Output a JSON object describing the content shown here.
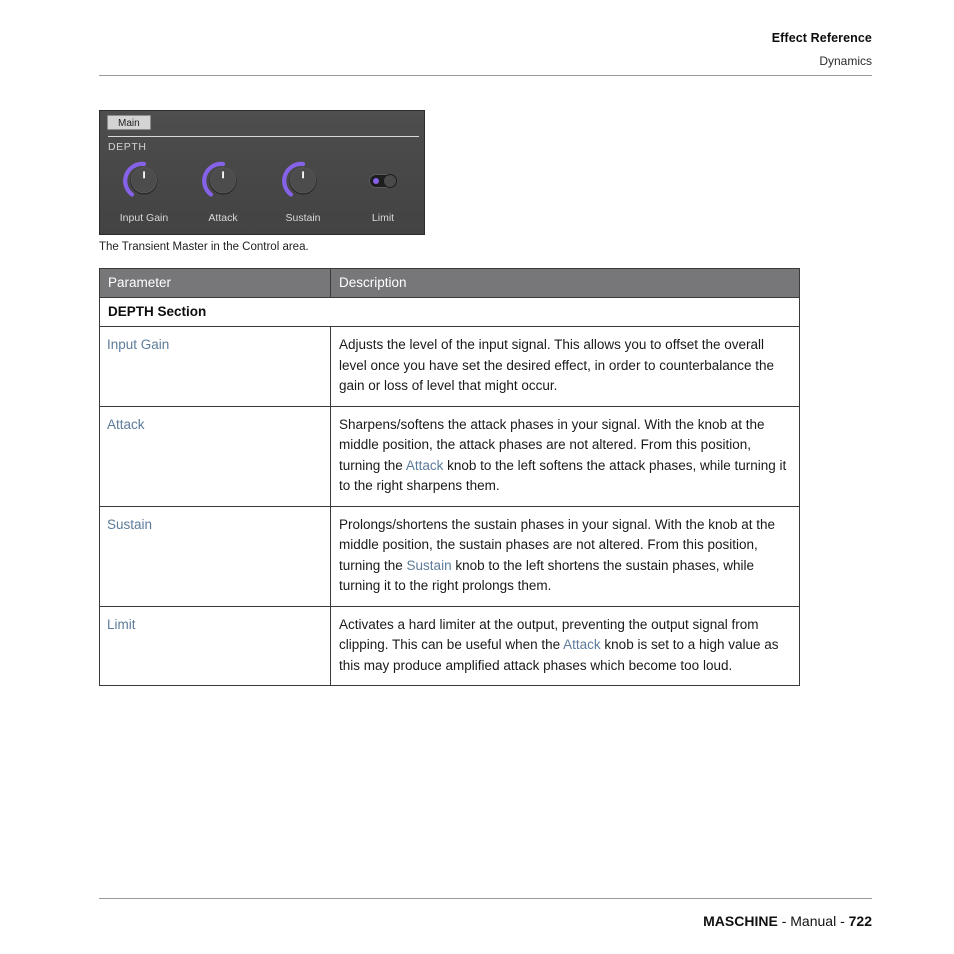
{
  "runninghead": {
    "title": "Effect Reference",
    "subtitle": "Dynamics"
  },
  "device": {
    "tab_label": "Main",
    "section_label": "DEPTH",
    "knobs": [
      {
        "label": "Input Gain",
        "icon": "knob-icon"
      },
      {
        "label": "Attack",
        "icon": "knob-icon"
      },
      {
        "label": "Sustain",
        "icon": "knob-icon"
      }
    ],
    "toggle": {
      "label": "Limit",
      "icon": "toggle-switch-icon",
      "state": "on"
    },
    "accent_color": "#8662e8",
    "panel_color": "#484848"
  },
  "caption": "The Transient Master in the Control area.",
  "table": {
    "headers": [
      "Parameter",
      "Description"
    ],
    "section_title": "DEPTH Section",
    "rows": [
      {
        "parameter": "Input Gain",
        "description_parts": [
          {
            "text": "Adjusts the level of the input signal. This allows you to offset the overall level once you have set the desired effect, in order to counterbalance the gain or loss of level that might occur.",
            "link": false
          }
        ]
      },
      {
        "parameter": "Attack",
        "description_parts": [
          {
            "text": "Sharpens/softens the attack phases in your signal. With the knob at the middle position, the attack phases are not altered. From this position, turning the ",
            "link": false
          },
          {
            "text": "Attack",
            "link": true
          },
          {
            "text": " knob to the left softens the attack phases, while turning it to the right sharpens them.",
            "link": false
          }
        ]
      },
      {
        "parameter": "Sustain",
        "description_parts": [
          {
            "text": "Prolongs/shortens the sustain phases in your signal. With the knob at the middle position, the sustain phases are not altered. From this position, turning the ",
            "link": false
          },
          {
            "text": "Sustain",
            "link": true
          },
          {
            "text": " knob to the left shortens the sustain phases, while turning it to the right prolongs them.",
            "link": false
          }
        ]
      },
      {
        "parameter": "Limit",
        "description_parts": [
          {
            "text": "Activates a hard limiter at the output, preventing the output signal from clipping. This can be useful when the ",
            "link": false
          },
          {
            "text": "Attack",
            "link": true
          },
          {
            "text": " knob is set to a high value as this may produce amplified attack phases which become too loud.",
            "link": false
          }
        ]
      }
    ]
  },
  "footer": {
    "product": "MASCHINE",
    "separator_one": " - ",
    "doc": "Manual",
    "separator_two": " - ",
    "page": "722"
  },
  "link_color": "#5d7c9b"
}
